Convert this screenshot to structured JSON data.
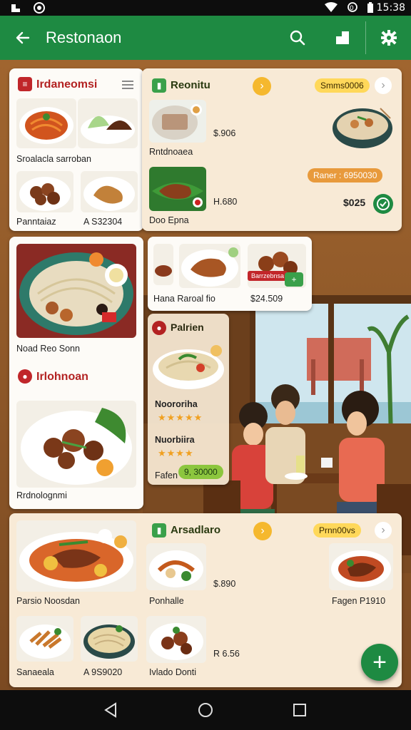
{
  "status_bar": {
    "time": "15:38",
    "icons": [
      "app-icon-1",
      "app-icon-2",
      "wifi-icon",
      "data-icon",
      "battery-icon"
    ]
  },
  "app_bar": {
    "title": "Restonaon",
    "icons": [
      "back-arrow-icon",
      "search-icon",
      "bookmark-icon",
      "settings-gear-icon"
    ]
  },
  "colors": {
    "primary": "#1e8a42",
    "accent_yellow": "#f5b82e",
    "heading_red": "#b32222",
    "card_cream": "#f8ead6"
  },
  "card_top_left": {
    "heading": "Irdaneomsi",
    "caption": "Sroalacla sarroban",
    "items": [
      {
        "label": "Panntaiaz"
      },
      {
        "label": "A S32304"
      }
    ]
  },
  "card_top_right": {
    "heading": "Reonitu",
    "pill": "Smms0006",
    "items": [
      {
        "label": "Rntdnoaea",
        "price": "$.906"
      },
      {
        "label": "Doo Epna",
        "price": "H.680"
      }
    ],
    "button_label": "Raner : 6950030",
    "price_total": "$025"
  },
  "card_mid_left": {
    "caption": "Noad Reo Sonn",
    "heading": "Irlohnoan",
    "caption2": "Rrdnolognmi"
  },
  "card_mid_small": {
    "label": "Hana Raroal fio",
    "price": "$24.509",
    "tag": "Barrzebnsa"
  },
  "scene_panel": {
    "heading": "Palrien",
    "items": [
      {
        "name": "Noororiha",
        "rating": "★★★★★"
      },
      {
        "name": "Nuorbiira",
        "rating": "★★★★"
      }
    ],
    "footer_label": "Fafen",
    "price": "9, 30000"
  },
  "card_bottom": {
    "heading": "Arsadlaro",
    "pill": "Prnn00vs",
    "items": [
      {
        "label": "Parsio Noosdan"
      },
      {
        "label": "Ponhalle",
        "price": "$.890"
      },
      {
        "label": "Fagen P1910"
      },
      {
        "label": "Sanaeala"
      },
      {
        "label": "A 9S9020"
      },
      {
        "label": "Ivlado Donti",
        "price": "R 6.56"
      }
    ]
  }
}
